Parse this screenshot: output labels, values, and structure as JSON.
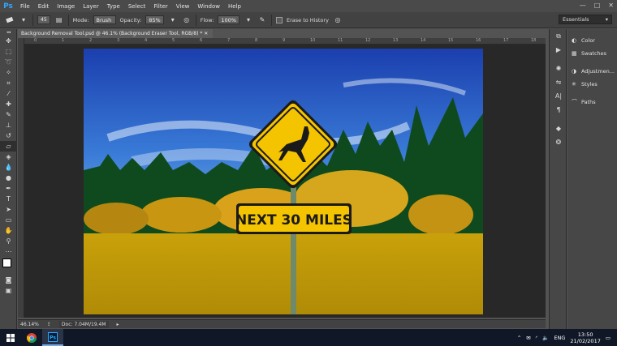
{
  "app": {
    "logo": "Ps"
  },
  "menu": [
    "File",
    "Edit",
    "Image",
    "Layer",
    "Type",
    "Select",
    "Filter",
    "View",
    "Window",
    "Help"
  ],
  "window_controls": [
    "—",
    "□",
    "✕"
  ],
  "options": {
    "brush_size": "45",
    "mode_label": "Mode:",
    "mode_value": "Brush",
    "opacity_label": "Opacity:",
    "opacity_value": "85%",
    "flow_label": "Flow:",
    "flow_value": "100%",
    "erase_history_label": "Erase to History"
  },
  "workspace": {
    "value": "Essentials"
  },
  "document": {
    "tab_title": "Background Removal Tool.psd @ 46.1% (Background Eraser Tool, RGB/8) *",
    "zoom": "46.14%",
    "doc_size": "Doc: 7.04M/19.4M"
  },
  "ruler_ticks": [
    "0",
    "1",
    "2",
    "3",
    "4",
    "5",
    "6",
    "7",
    "8",
    "9",
    "10",
    "11",
    "12",
    "13",
    "14",
    "15",
    "16",
    "17",
    "18"
  ],
  "photo": {
    "sign_text": "NEXT 30 MILES"
  },
  "panels": {
    "group1": [
      "Color",
      "Swatches"
    ],
    "group2": [
      "Adjustmen...",
      "Styles"
    ],
    "group3": [
      "Paths"
    ]
  },
  "taskbar": {
    "language": "ENG",
    "time": "13:50",
    "date": "21/02/2017"
  },
  "colors": {
    "accent": "#31a8ff",
    "sign_yellow": "#f5c400",
    "taskbar": "#101828"
  }
}
